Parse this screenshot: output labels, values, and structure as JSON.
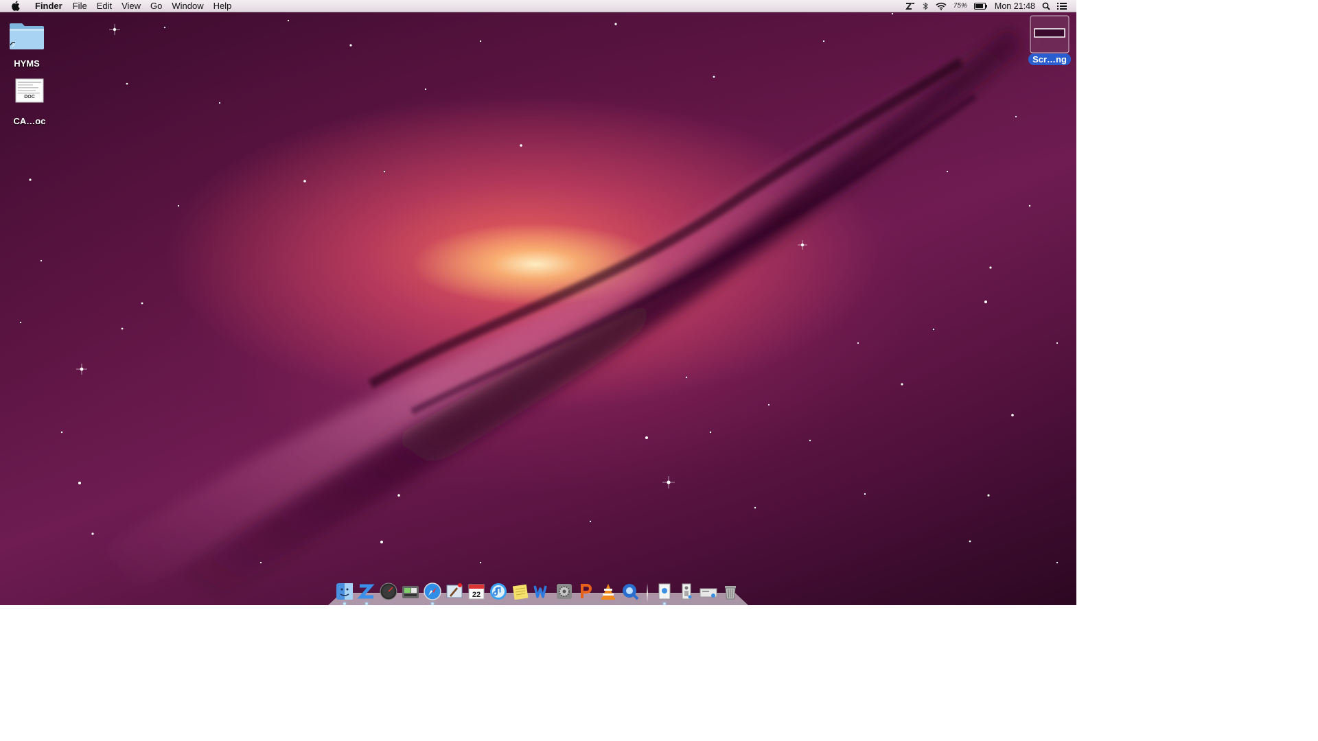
{
  "menubar": {
    "apple_icon": "apple-icon",
    "app_name": "Finder",
    "menus": [
      "File",
      "Edit",
      "View",
      "Go",
      "Window",
      "Help"
    ],
    "tray": {
      "battery_percent": "75%",
      "clock": "Mon 21:48"
    }
  },
  "desktop": {
    "icons": [
      {
        "label": "HYMS",
        "icon": "folder-alias-icon"
      },
      {
        "label": "CA…oc",
        "icon": "doc-file-icon",
        "badge": "DOC"
      },
      {
        "label": "Scr…ng",
        "icon": "screenshot-png-icon",
        "selected": true
      }
    ]
  },
  "dock": {
    "calendar_date": "22",
    "apps": [
      "finder-icon",
      "zend-studio-icon",
      "dashboard-icon",
      "image-capture-icon",
      "safari-icon",
      "mail-icon",
      "ical-icon",
      "itunes-icon",
      "stickies-icon",
      "word-icon",
      "system-preferences-icon",
      "powerpoint-icon",
      "vlc-icon",
      "quicktime-icon"
    ],
    "stacks": [
      "applications-stack-icon",
      "documents-stack-icon",
      "downloads-stack-icon",
      "trash-icon"
    ]
  },
  "colors": {
    "selection_blue": "#2a5ecf",
    "background_deep": "#3a0b2c",
    "galaxy_core": "#fff5c8"
  }
}
